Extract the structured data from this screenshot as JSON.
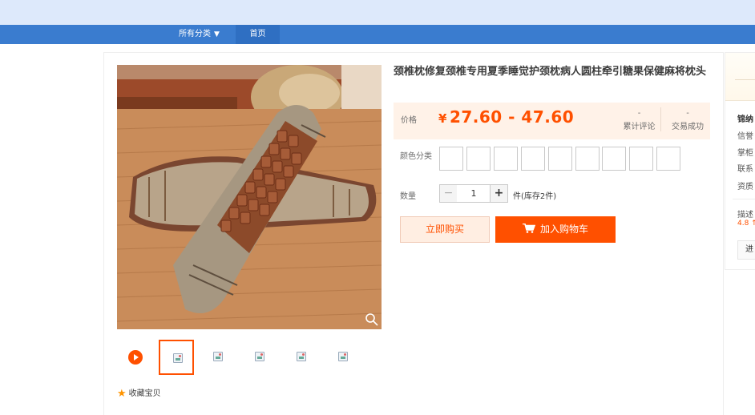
{
  "nav": {
    "all_categories": "所有分类",
    "home": "首页"
  },
  "product": {
    "title": "颈椎枕修复颈椎专用夏季睡觉护颈枕病人圆柱牵引糖果保健麻将枕头",
    "price_label": "价格",
    "currency": "¥",
    "price": "27.60 - 47.60",
    "reviews_count": "-",
    "reviews_label": "累计评论",
    "sales_count": "-",
    "sales_label": "交易成功",
    "color_label": "颜色分类",
    "quantity_label": "数量",
    "quantity": "1",
    "stock_text": "件(库存2件)",
    "buy_now": "立即购买",
    "add_to_cart": "加入购物车",
    "favorite": "收藏宝贝"
  },
  "shop": {
    "name": "锦纳",
    "rows": [
      "信誉",
      "掌柜",
      "联系",
      "资质"
    ],
    "desc_label": "描述",
    "desc_score": "4.8 ↑",
    "enter": "进"
  },
  "colors": {
    "accent": "#ff5000",
    "nav_bar": "#3a7ccf",
    "top_band": "#dde9fb"
  }
}
